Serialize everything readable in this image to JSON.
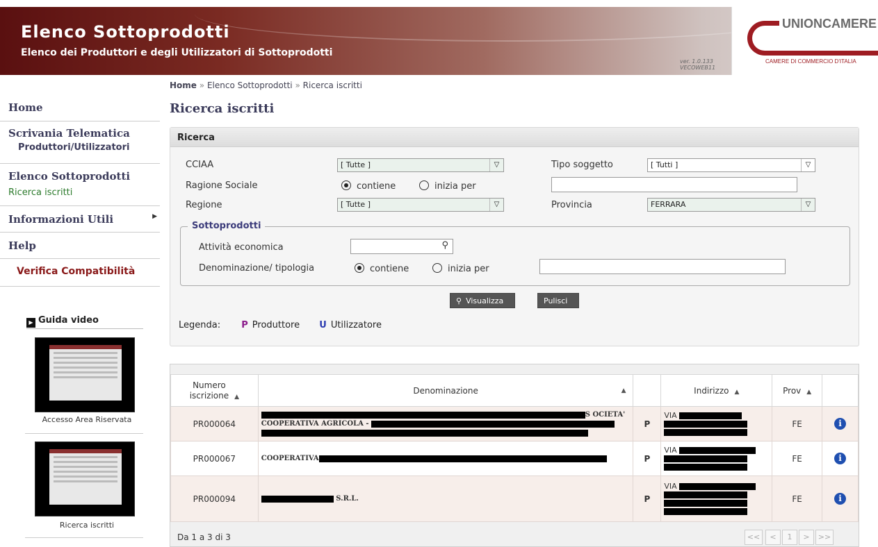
{
  "header": {
    "title": "Elenco Sottoprodotti",
    "subtitle": "Elenco dei Produttori e degli Utilizzatori di Sottoprodotti",
    "version_line1": "ver. 1.0.133",
    "version_line2": "VECOWEB11",
    "logo_name": "UNIONCAMERE",
    "logo_tagline": "CAMERE DI COMMERCIO D'ITALIA"
  },
  "breadcrumb": {
    "home": "Home",
    "sep": "»",
    "item1": "Elenco Sottoprodotti",
    "item2": "Ricerca iscritti"
  },
  "sidebar": {
    "home": "Home",
    "scrivania": "Scrivania Telematica",
    "produttori": "Produttori/Utilizzatori",
    "elenco": "Elenco Sottoprodotti",
    "ricerca": "Ricerca iscritti",
    "informazioni": "Informazioni Utili",
    "help": "Help",
    "verifica": "Verifica Compatibilità",
    "guida_video": "Guida video",
    "video1_caption": "Accesso Area Riservata",
    "video2_caption": "Ricerca iscritti"
  },
  "page_title": "Ricerca iscritti",
  "search": {
    "panel_title": "Ricerca",
    "cciaa_label": "CCIAA",
    "cciaa_value": "[ Tutte ]",
    "tipo_label": "Tipo soggetto",
    "tipo_value": "[ Tutti ]",
    "ragione_label": "Ragione Sociale",
    "opt_contiene": "contiene",
    "opt_inizia": "inizia per",
    "regione_label": "Regione",
    "regione_value": "[ Tutte ]",
    "provincia_label": "Provincia",
    "provincia_value": "FERRARA",
    "sottoprodotti_legend": "Sottoprodotti",
    "attivita_label": "Attività economica",
    "denominazione_label": "Denominazione/ tipologia",
    "btn_visualizza": "Visualizza",
    "btn_pulisci": "Pulisci",
    "legenda_label": "Legenda:",
    "legend_p": "P",
    "legend_p_text": "Produttore",
    "legend_u": "U",
    "legend_u_text": "Utilizzatore"
  },
  "grid": {
    "col_numero_1": "Numero",
    "col_numero_2": "iscrizione",
    "col_denominazione": "Denominazione",
    "col_indirizzo": "Indirizzo",
    "col_prov": "Prov",
    "rows": [
      {
        "numero": "PR000064",
        "den_a": "S OCIETA'",
        "den_b": "COOPERATIVA AGRICOLA -",
        "tipo": "P",
        "addr": "VIA",
        "prov": "FE"
      },
      {
        "numero": "PR000067",
        "den_a": "COOPERATIVA",
        "tipo": "P",
        "addr": "VIA",
        "prov": "FE"
      },
      {
        "numero": "PR000094",
        "den_a": "S.R.L.",
        "tipo": "P",
        "addr": "VIA",
        "prov": "FE"
      }
    ],
    "footer": "Da 1 a 3 di 3",
    "pager": {
      "first": "<<",
      "prev": "<",
      "page": "1",
      "next": ">",
      "last": ">>"
    }
  }
}
